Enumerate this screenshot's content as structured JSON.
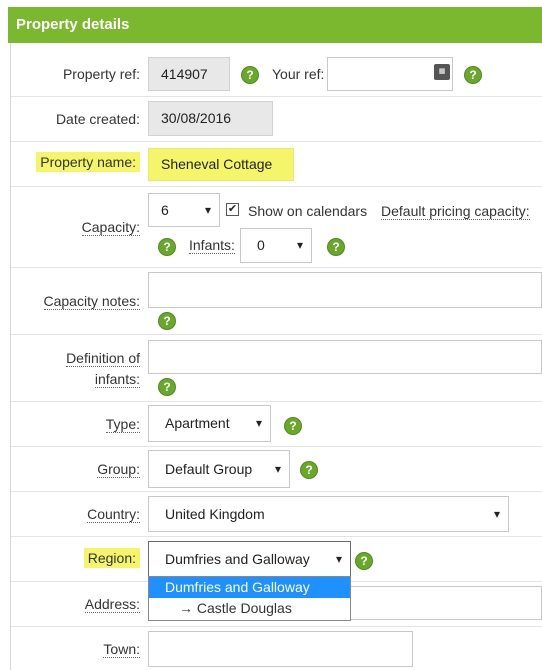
{
  "section": {
    "title": "Property details"
  },
  "property_ref": {
    "label": "Property ref:",
    "value": "414907"
  },
  "your_ref": {
    "label": "Your ref:",
    "value": ""
  },
  "date_created": {
    "label": "Date created:",
    "value": "30/08/2016"
  },
  "property_name": {
    "label": "Property name:",
    "value": "Sheneval Cottage"
  },
  "capacity": {
    "label": "Capacity:",
    "value": "6",
    "show_on_calendars_label": "Show on calendars",
    "show_on_calendars_checked": true,
    "default_pricing_label": "Default pricing capacity:",
    "infants_label": "Infants:",
    "infants_value": "0"
  },
  "capacity_notes": {
    "label": "Capacity notes:",
    "value": ""
  },
  "definition_of_infants": {
    "label_line1": "Definition of",
    "label_line2": "infants:",
    "value": ""
  },
  "type": {
    "label": "Type:",
    "value": "Apartment"
  },
  "group": {
    "label": "Group:",
    "value": "Default Group"
  },
  "country": {
    "label": "Country:",
    "value": "United Kingdom"
  },
  "region": {
    "label": "Region:",
    "value": "Dumfries and Galloway",
    "options": [
      "Dumfries and Galloway",
      "→ Castle Douglas"
    ]
  },
  "address": {
    "label": "Address:",
    "value": ""
  },
  "town": {
    "label": "Town:",
    "value": ""
  },
  "help_glyph": "?",
  "check_glyph": "✔"
}
